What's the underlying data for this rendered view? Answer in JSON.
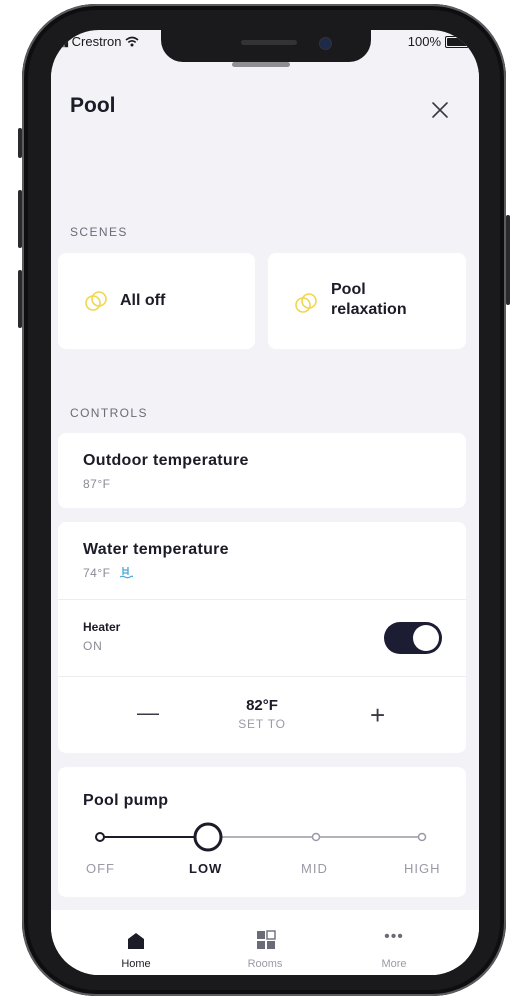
{
  "status_bar": {
    "carrier": "Crestron",
    "battery": "100%"
  },
  "header": {
    "title": "Pool",
    "close_icon": "close-icon"
  },
  "scenes": {
    "section_label": "SCENES",
    "items": [
      {
        "label": "All off",
        "icon": "scene-rings-icon"
      },
      {
        "label_line1": "Pool",
        "label_line2": "relaxation",
        "icon": "scene-rings-icon"
      }
    ],
    "icon_color": "#f2d64b"
  },
  "controls": {
    "section_label": "CONTROLS",
    "outdoor": {
      "title": "Outdoor temperature",
      "value": "87°F"
    },
    "water": {
      "title": "Water temperature",
      "value": "74°F",
      "heater_label": "Heater",
      "heater_state": "ON",
      "heater_on": true,
      "setpoint": "82°F",
      "setpoint_caption": "SET TO",
      "minus": "—",
      "plus": "+"
    },
    "pump": {
      "title": "Pool pump",
      "levels": [
        "OFF",
        "LOW",
        "MID",
        "HIGH"
      ],
      "selected": "LOW"
    }
  },
  "tabbar": {
    "items": [
      {
        "label": "Home",
        "icon": "home-icon",
        "active": true
      },
      {
        "label": "Rooms",
        "icon": "rooms-grid-icon",
        "active": false
      },
      {
        "label": "More",
        "icon": "more-dots-icon",
        "active": false
      }
    ]
  },
  "colors": {
    "accent": "#1c1c33",
    "background": "#f2f2f7",
    "card": "#ffffff"
  }
}
